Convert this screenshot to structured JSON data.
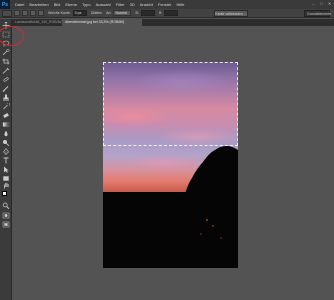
{
  "app": {
    "logo": "Ps"
  },
  "menu": [
    "Datei",
    "Bearbeiten",
    "Bild",
    "Ebene",
    "Typo",
    "Auswahl",
    "Filter",
    "3D",
    "Ansicht",
    "Fenster",
    "Hilfe"
  ],
  "window_controls": [
    "–",
    "□",
    "✕"
  ],
  "options": {
    "feather_label": "Weiche Kante:",
    "feather_value": "0 px",
    "antialias_label": "Glätten",
    "style_label": "Art:",
    "style_value": "Normal",
    "width_label": "B:",
    "height_label": "H:",
    "refine_button": "Kante verbessern ...",
    "workspace": "Grundelemente"
  },
  "tabs": [
    {
      "label": "Landschaftsbild_100_RGB/8#)"
    },
    {
      "label": "Abendhimmel.jpg bei 33,3% (RGB/8#)"
    }
  ],
  "tools": [
    "move-icon",
    "rectangular-marquee-icon",
    "lasso-icon",
    "quick-selection-icon",
    "crop-icon",
    "eyedropper-icon",
    "healing-brush-icon",
    "brush-icon",
    "clone-stamp-icon",
    "history-brush-icon",
    "eraser-icon",
    "gradient-icon",
    "blur-icon",
    "dodge-icon",
    "pen-icon",
    "type-icon",
    "path-selection-icon",
    "shape-icon",
    "hand-icon",
    "zoom-icon"
  ],
  "colors": {
    "annotation": "#e0242a",
    "foreground": "#ffffff",
    "background": "#000000"
  }
}
